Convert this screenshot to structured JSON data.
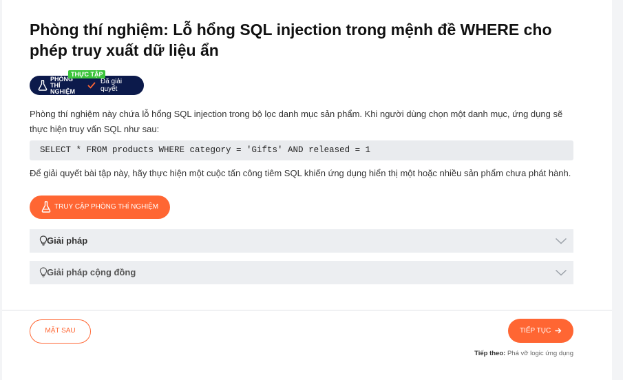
{
  "lab": {
    "title": "Phòng thí nghiệm: Lỗ hổng SQL injection trong mệnh đề WHERE cho phép truy xuất dữ liệu ẩn",
    "badge_tag": "THỰC TẬP",
    "badge_type": "PHÒNG THÍ NGHIỆM",
    "badge_status": "Đã giải quyết",
    "description": "Phòng thí nghiệm này chứa lỗ hổng SQL injection trong bộ lọc danh mục sản phẩm. Khi người dùng chọn một danh mục, ứng dụng sẽ thực hiện truy vấn SQL như sau:",
    "code": "SELECT * FROM products WHERE category = 'Gifts' AND released = 1",
    "task": "Để giải quyết bài tập này, hãy thực hiện một cuộc tấn công tiêm SQL khiến ứng dụng hiển thị một hoặc nhiều sản phẩm chưa phát hành.",
    "access_button": "TRUY CẬP PHÒNG THÍ NGHIỆM"
  },
  "accordions": [
    {
      "label": "Giải pháp",
      "icon": "lightbulb-icon"
    },
    {
      "label": "Giải pháp cộng đồng",
      "icon": "community-lightbulb-icon"
    }
  ],
  "footer": {
    "prev_button": "MẶT SAU",
    "next_button": "TIẾP TỤC",
    "next_hint_label": "Tiếp theo:",
    "next_hint_value": "Phá vỡ logic ứng dụng"
  },
  "colors": {
    "accent": "#ff6633",
    "badge_bg": "#0c1a4b",
    "badge_tag": "#3cc43c",
    "accordion_bg": "#eceef1"
  }
}
